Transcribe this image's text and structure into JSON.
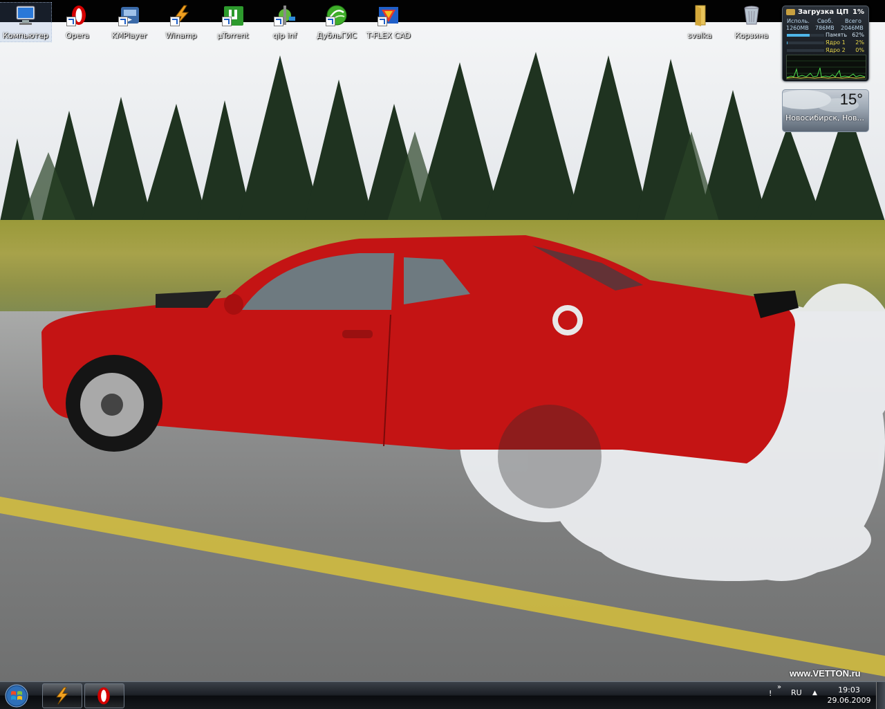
{
  "desktop": {
    "icons": [
      {
        "label": "Компьютер",
        "icon": "computer-icon"
      },
      {
        "label": "Opera",
        "icon": "opera-icon"
      },
      {
        "label": "KMPlayer",
        "icon": "kmplayer-icon"
      },
      {
        "label": "Winamp",
        "icon": "winamp-icon"
      },
      {
        "label": "µTorrent",
        "icon": "utorrent-icon"
      },
      {
        "label": "qip inf",
        "icon": "qip-icon"
      },
      {
        "label": "ДубльГИС",
        "icon": "dublgis-icon"
      },
      {
        "label": "T-FLEX CAD",
        "icon": "tflex-icon"
      },
      {
        "label": "svalka",
        "icon": "folder-icon"
      },
      {
        "label": "Корзина",
        "icon": "recycle-bin-icon"
      }
    ]
  },
  "cpu_gadget": {
    "title": "Загрузка ЦП",
    "cpu_percent": "1%",
    "headers": [
      "Исполь.",
      "Своб.",
      "Всего"
    ],
    "values": [
      "1260MB",
      "786MB",
      "2046MB"
    ],
    "rows": [
      {
        "name": "Память",
        "value": "62%",
        "fill": 0.62
      },
      {
        "name": "Ядро 1",
        "value": "2%",
        "fill": 0.02
      },
      {
        "name": "Ядро 2",
        "value": "0%",
        "fill": 0.0
      }
    ]
  },
  "weather_gadget": {
    "temperature": "15°",
    "city": "Новосибирск, Нов..."
  },
  "wallpaper": {
    "watermark": "www.VETTON.ru"
  },
  "taskbar": {
    "pinned": [
      {
        "app": "Winamp",
        "icon": "winamp-icon"
      },
      {
        "app": "Opera",
        "icon": "opera-icon"
      }
    ],
    "tray": {
      "show_hidden": "!",
      "chevron": "»",
      "language": "RU",
      "time": "19:03",
      "date": "29.06.2009"
    }
  },
  "colors": {
    "taskbar": "#16191d",
    "car": "#c41414",
    "accent": "#4fb6e8"
  }
}
